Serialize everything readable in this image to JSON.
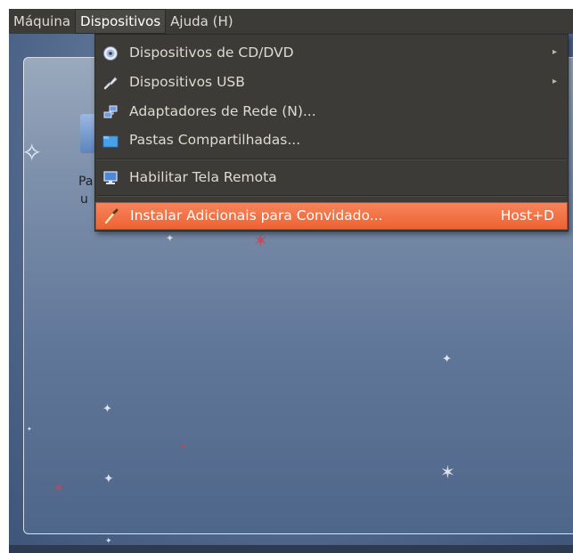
{
  "menubar": {
    "items": [
      {
        "label": "Máquina"
      },
      {
        "label": "Dispositivos"
      },
      {
        "label": "Ajuda (H)"
      }
    ]
  },
  "dropdown": {
    "items": [
      {
        "label": "Dispositivos de CD/DVD",
        "icon": "disc-icon",
        "submenu": true
      },
      {
        "label": "Dispositivos USB",
        "icon": "usb-plug-icon",
        "submenu": true
      },
      {
        "label": "Adaptadores de Rede (N)...",
        "icon": "network-adapter-icon",
        "submenu": false
      },
      {
        "label": "Pastas Compartilhadas...",
        "icon": "shared-folder-icon",
        "submenu": false
      },
      {
        "label": "Habilitar Tela Remota",
        "icon": "remote-display-icon",
        "submenu": false
      },
      {
        "label": "Instalar Adicionais para Convidado...",
        "icon": "install-addons-icon",
        "submenu": false,
        "shortcut": "Host+D",
        "highlighted": true
      }
    ]
  },
  "desktop": {
    "icon_label_line1": "Pa",
    "icon_label_line2": "u"
  },
  "colors": {
    "menubar_bg": "#3c3b37",
    "highlight": "#f07746",
    "menu_text": "#dfdbd2"
  }
}
